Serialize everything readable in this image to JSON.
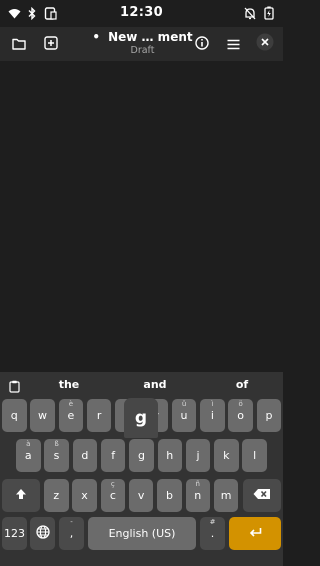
{
  "status_bar": {
    "time": "12:30",
    "left_icons": [
      "wifi-icon",
      "bluetooth-icon",
      "phone-link-icon"
    ],
    "right_icons": [
      "notifications-off-icon",
      "battery-charging-icon"
    ]
  },
  "header": {
    "title_dot": "•",
    "title": "New … ment",
    "subtitle": "Draft",
    "left_buttons": [
      "folder-icon",
      "add-icon"
    ],
    "right_buttons": [
      "info-icon",
      "menu-icon",
      "close-icon"
    ]
  },
  "keyboard": {
    "suggestions": [
      "the",
      "and",
      "of"
    ],
    "row1": [
      {
        "key": "q",
        "alt": ""
      },
      {
        "key": "w",
        "alt": ""
      },
      {
        "key": "e",
        "alt": "è"
      },
      {
        "key": "r",
        "alt": ""
      },
      {
        "key": "t",
        "alt": ""
      },
      {
        "key": "y",
        "alt": ""
      },
      {
        "key": "u",
        "alt": "û"
      },
      {
        "key": "i",
        "alt": "ì"
      },
      {
        "key": "o",
        "alt": "ö"
      },
      {
        "key": "p",
        "alt": ""
      }
    ],
    "row2": [
      {
        "key": "a",
        "alt": "à"
      },
      {
        "key": "s",
        "alt": "ß"
      },
      {
        "key": "d",
        "alt": ""
      },
      {
        "key": "f",
        "alt": ""
      },
      {
        "key": "g",
        "alt": ""
      },
      {
        "key": "h",
        "alt": ""
      },
      {
        "key": "j",
        "alt": ""
      },
      {
        "key": "k",
        "alt": ""
      },
      {
        "key": "l",
        "alt": ""
      }
    ],
    "row3": [
      {
        "key": "z",
        "alt": ""
      },
      {
        "key": "x",
        "alt": ""
      },
      {
        "key": "c",
        "alt": "ç"
      },
      {
        "key": "v",
        "alt": ""
      },
      {
        "key": "b",
        "alt": ""
      },
      {
        "key": "n",
        "alt": "ñ"
      },
      {
        "key": "m",
        "alt": ""
      }
    ],
    "popup_key": "g",
    "numbers_key": "123",
    "comma_key": ",",
    "space_label": "English (US)",
    "period_key": ".",
    "period_alt": "#",
    "comma_alt": "-"
  },
  "colors": {
    "background": "#1e1e1e",
    "header": "#2a2a2a",
    "keyboard": "#333333",
    "key": "#6b6b6b",
    "enter_key": "#d39200"
  }
}
